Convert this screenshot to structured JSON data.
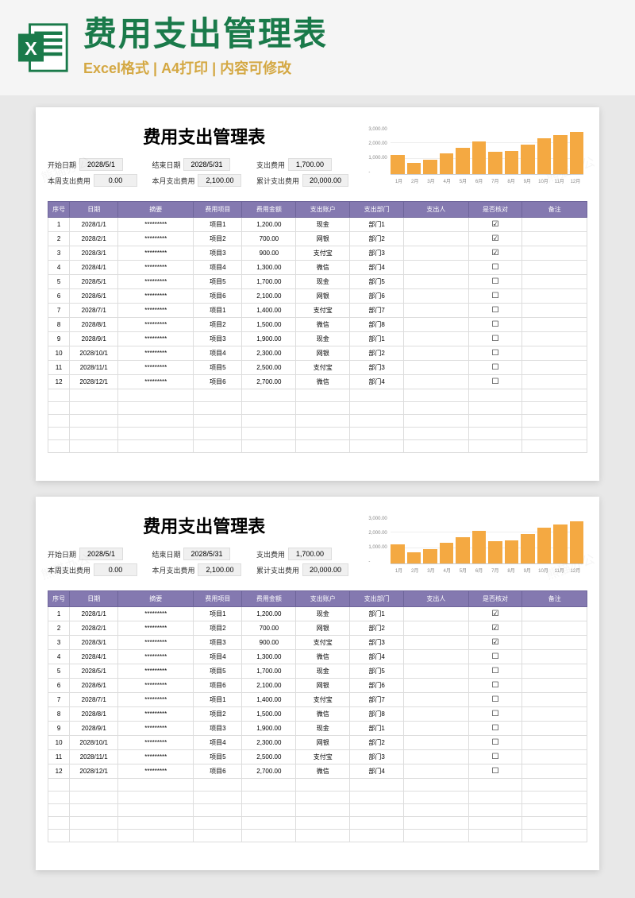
{
  "banner": {
    "title": "费用支出管理表",
    "subtitle": "Excel格式 | A4打印 | 内容可修改"
  },
  "sheet": {
    "title": "费用支出管理表",
    "summary": {
      "start_date_label": "开始日期",
      "start_date": "2028/5/1",
      "end_date_label": "结束日期",
      "end_date": "2028/5/31",
      "expense_label": "支出费用",
      "expense": "1,700.00",
      "week_label": "本周支出费用",
      "week": "0.00",
      "month_label": "本月支出费用",
      "month": "2,100.00",
      "total_label": "累计支出费用",
      "total": "20,000.00"
    },
    "columns": [
      "序号",
      "日期",
      "摘要",
      "费用项目",
      "费用金额",
      "支出账户",
      "支出部门",
      "支出人",
      "是否核对",
      "备注"
    ],
    "rows": [
      {
        "n": "1",
        "date": "2028/1/1",
        "summary": "*********",
        "item": "项目1",
        "amount": "1,200.00",
        "account": "现金",
        "dept": "部门1",
        "person": "",
        "checked": "☑",
        "remark": ""
      },
      {
        "n": "2",
        "date": "2028/2/1",
        "summary": "*********",
        "item": "项目2",
        "amount": "700.00",
        "account": "网银",
        "dept": "部门2",
        "person": "",
        "checked": "☑",
        "remark": ""
      },
      {
        "n": "3",
        "date": "2028/3/1",
        "summary": "*********",
        "item": "项目3",
        "amount": "900.00",
        "account": "支付宝",
        "dept": "部门3",
        "person": "",
        "checked": "☑",
        "remark": ""
      },
      {
        "n": "4",
        "date": "2028/4/1",
        "summary": "*********",
        "item": "项目4",
        "amount": "1,300.00",
        "account": "微信",
        "dept": "部门4",
        "person": "",
        "checked": "☐",
        "remark": ""
      },
      {
        "n": "5",
        "date": "2028/5/1",
        "summary": "*********",
        "item": "项目5",
        "amount": "1,700.00",
        "account": "现金",
        "dept": "部门5",
        "person": "",
        "checked": "☐",
        "remark": ""
      },
      {
        "n": "6",
        "date": "2028/6/1",
        "summary": "*********",
        "item": "项目6",
        "amount": "2,100.00",
        "account": "网银",
        "dept": "部门6",
        "person": "",
        "checked": "☐",
        "remark": ""
      },
      {
        "n": "7",
        "date": "2028/7/1",
        "summary": "*********",
        "item": "项目1",
        "amount": "1,400.00",
        "account": "支付宝",
        "dept": "部门7",
        "person": "",
        "checked": "☐",
        "remark": ""
      },
      {
        "n": "8",
        "date": "2028/8/1",
        "summary": "*********",
        "item": "项目2",
        "amount": "1,500.00",
        "account": "微信",
        "dept": "部门8",
        "person": "",
        "checked": "☐",
        "remark": ""
      },
      {
        "n": "9",
        "date": "2028/9/1",
        "summary": "*********",
        "item": "项目3",
        "amount": "1,900.00",
        "account": "现金",
        "dept": "部门1",
        "person": "",
        "checked": "☐",
        "remark": ""
      },
      {
        "n": "10",
        "date": "2028/10/1",
        "summary": "*********",
        "item": "项目4",
        "amount": "2,300.00",
        "account": "网银",
        "dept": "部门2",
        "person": "",
        "checked": "☐",
        "remark": ""
      },
      {
        "n": "11",
        "date": "2028/11/1",
        "summary": "*********",
        "item": "项目5",
        "amount": "2,500.00",
        "account": "支付宝",
        "dept": "部门3",
        "person": "",
        "checked": "☐",
        "remark": ""
      },
      {
        "n": "12",
        "date": "2028/12/1",
        "summary": "*********",
        "item": "项目6",
        "amount": "2,700.00",
        "account": "微信",
        "dept": "部门4",
        "person": "",
        "checked": "☐",
        "remark": ""
      }
    ],
    "empty_rows": 5
  },
  "chart_data": {
    "type": "bar",
    "categories": [
      "1月",
      "2月",
      "3月",
      "4月",
      "5月",
      "6月",
      "7月",
      "8月",
      "9月",
      "10月",
      "11月",
      "12月"
    ],
    "values": [
      1200,
      700,
      900,
      1300,
      1700,
      2100,
      1400,
      1500,
      1900,
      2300,
      2500,
      2700
    ],
    "ylabels": [
      "3,000.00",
      "2,000.00",
      "1,000.00",
      "-"
    ],
    "ylim": [
      0,
      3000
    ],
    "title": "",
    "xlabel": "",
    "ylabel": ""
  },
  "watermark": "熊猫办公"
}
